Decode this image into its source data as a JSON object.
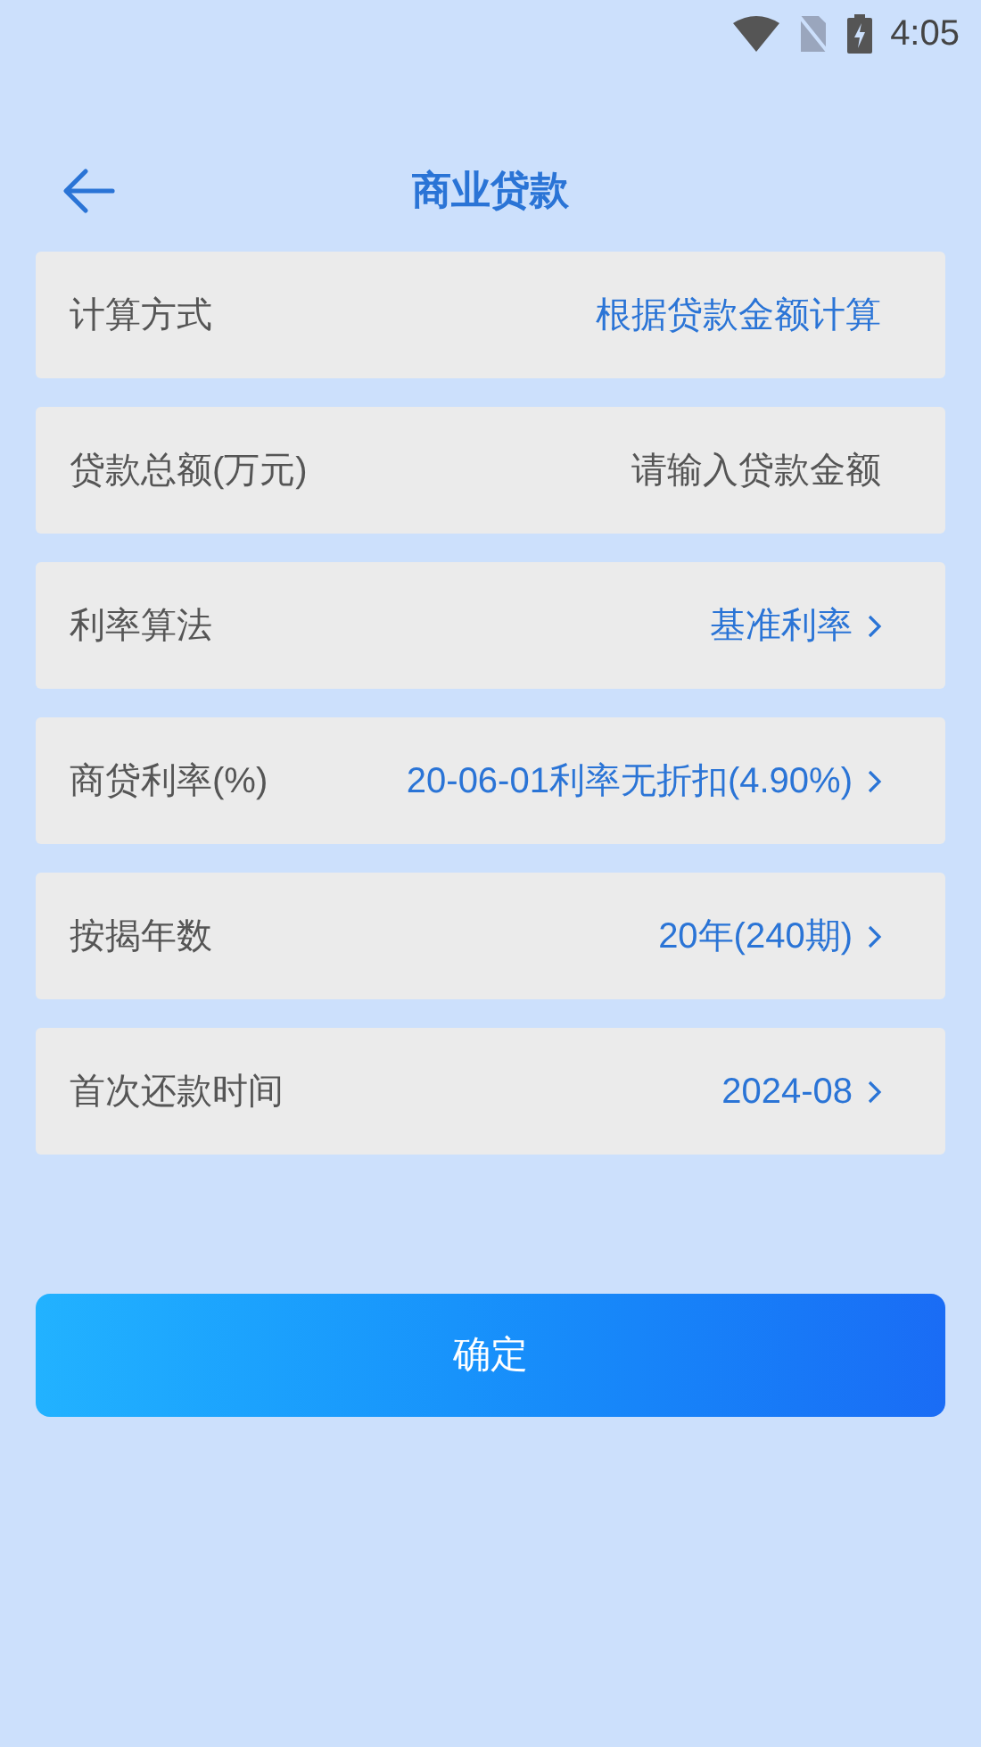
{
  "status_bar": {
    "time": "4:05"
  },
  "header": {
    "title": "商业贷款"
  },
  "rows": [
    {
      "kind": "text",
      "label": "计算方式",
      "value": "根据贷款金额计算"
    },
    {
      "kind": "input",
      "label": "贷款总额(万元)",
      "placeholder": "请输入贷款金额"
    },
    {
      "kind": "select",
      "label": "利率算法",
      "value": "基准利率"
    },
    {
      "kind": "select",
      "label": "商贷利率(%)",
      "value": "20-06-01利率无折扣(4.90%)"
    },
    {
      "kind": "select",
      "label": "按揭年数",
      "value": "20年(240期)"
    },
    {
      "kind": "select",
      "label": "首次还款时间",
      "value": "2024-08"
    }
  ],
  "submit_button": "确定"
}
